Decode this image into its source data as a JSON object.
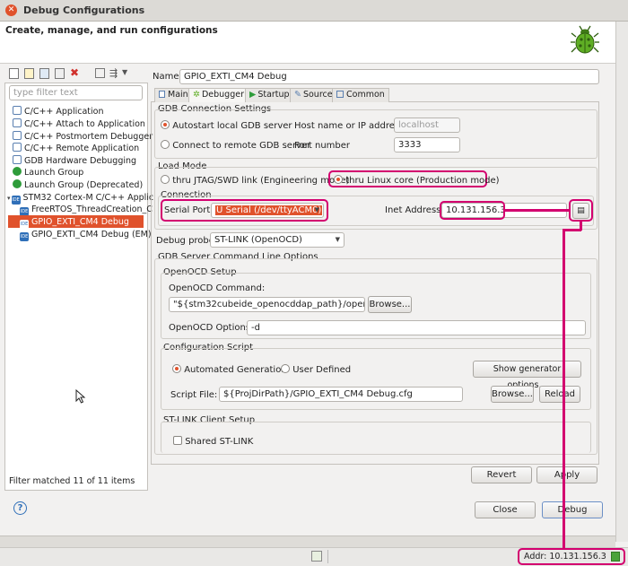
{
  "window": {
    "title": "Debug Configurations",
    "close_glyph": "✕"
  },
  "header": {
    "subtitle": "Create, manage, and run configurations"
  },
  "sidebar": {
    "filter_placeholder": "type filter text",
    "items": [
      {
        "label": "C/C++ Application",
        "icon": "c-icon"
      },
      {
        "label": "C/C++ Attach to Application",
        "icon": "c-icon"
      },
      {
        "label": "C/C++ Postmortem Debugger",
        "icon": "c-icon"
      },
      {
        "label": "C/C++ Remote Application",
        "icon": "c-icon"
      },
      {
        "label": "GDB Hardware Debugging",
        "icon": "c-icon"
      },
      {
        "label": "Launch Group",
        "icon": "launch-icon"
      },
      {
        "label": "Launch Group (Deprecated)",
        "icon": "launch-icon"
      },
      {
        "label": "STM32 Cortex-M C/C++ Applic",
        "icon": "ide-icon"
      },
      {
        "label": "FreeRTOS_ThreadCreation_C",
        "icon": "ide-icon"
      },
      {
        "label": "GPIO_EXTI_CM4 Debug",
        "icon": "ide-icon"
      },
      {
        "label": "GPIO_EXTI_CM4 Debug (EM)",
        "icon": "ide-icon"
      }
    ],
    "ide_badge": "IDE",
    "status": "Filter matched 11 of 11 items"
  },
  "form": {
    "name_label": "Name:",
    "name_value": "GPIO_EXTI_CM4 Debug",
    "tabs": [
      "Main",
      "Debugger",
      "Startup",
      "Source",
      "Common"
    ],
    "gdb_group": "GDB Connection Settings",
    "autostart": "Autostart local GDB server",
    "connect_remote": "Connect to remote GDB server",
    "host_label": "Host name or IP address",
    "host_value": "localhost",
    "port_label": "Port number",
    "port_value": "3333",
    "load_group": "Load Mode",
    "load_jtag": "thru JTAG/SWD link (Engineering mode)",
    "load_linux": "thru Linux core (Production mode)",
    "connection_group": "Connection",
    "serial_label": "Serial Port:",
    "serial_value": "U Serial (/dev/ttyACM0)",
    "inet_label": "Inet Address:",
    "inet_value": "10.131.156.3",
    "probe_label": "Debug probe",
    "probe_value": "ST-LINK (OpenOCD)",
    "gdb_cmd_group": "GDB Server Command Line Options",
    "openocd_group": "OpenOCD Setup",
    "openocd_cmd_label": "OpenOCD Command:",
    "openocd_cmd_value": "\"${stm32cubeide_openocddap_path}/openocd\"",
    "browse": "Browse...",
    "openocd_opts_label": "OpenOCD Options :",
    "openocd_opts_value": "-d",
    "config_group": "Configuration Script",
    "auto_gen": "Automated Generation",
    "user_def": "User Defined",
    "show_gen": "Show generator options...",
    "script_label": "Script File:",
    "script_value": "${ProjDirPath}/GPIO_EXTI_CM4 Debug.cfg",
    "reload": "Reload",
    "stlink_group": "ST-LINK Client Setup",
    "shared_stlink": "Shared ST-LINK",
    "revert": "Revert",
    "apply": "Apply"
  },
  "footer": {
    "close": "Close",
    "debug": "Debug",
    "help_glyph": "?"
  },
  "statusbar": {
    "addr": "Addr: 10.131.156.3"
  },
  "colors": {
    "highlight": "#d3006f",
    "selection": "#e0522c",
    "accent": "#e0522c"
  }
}
